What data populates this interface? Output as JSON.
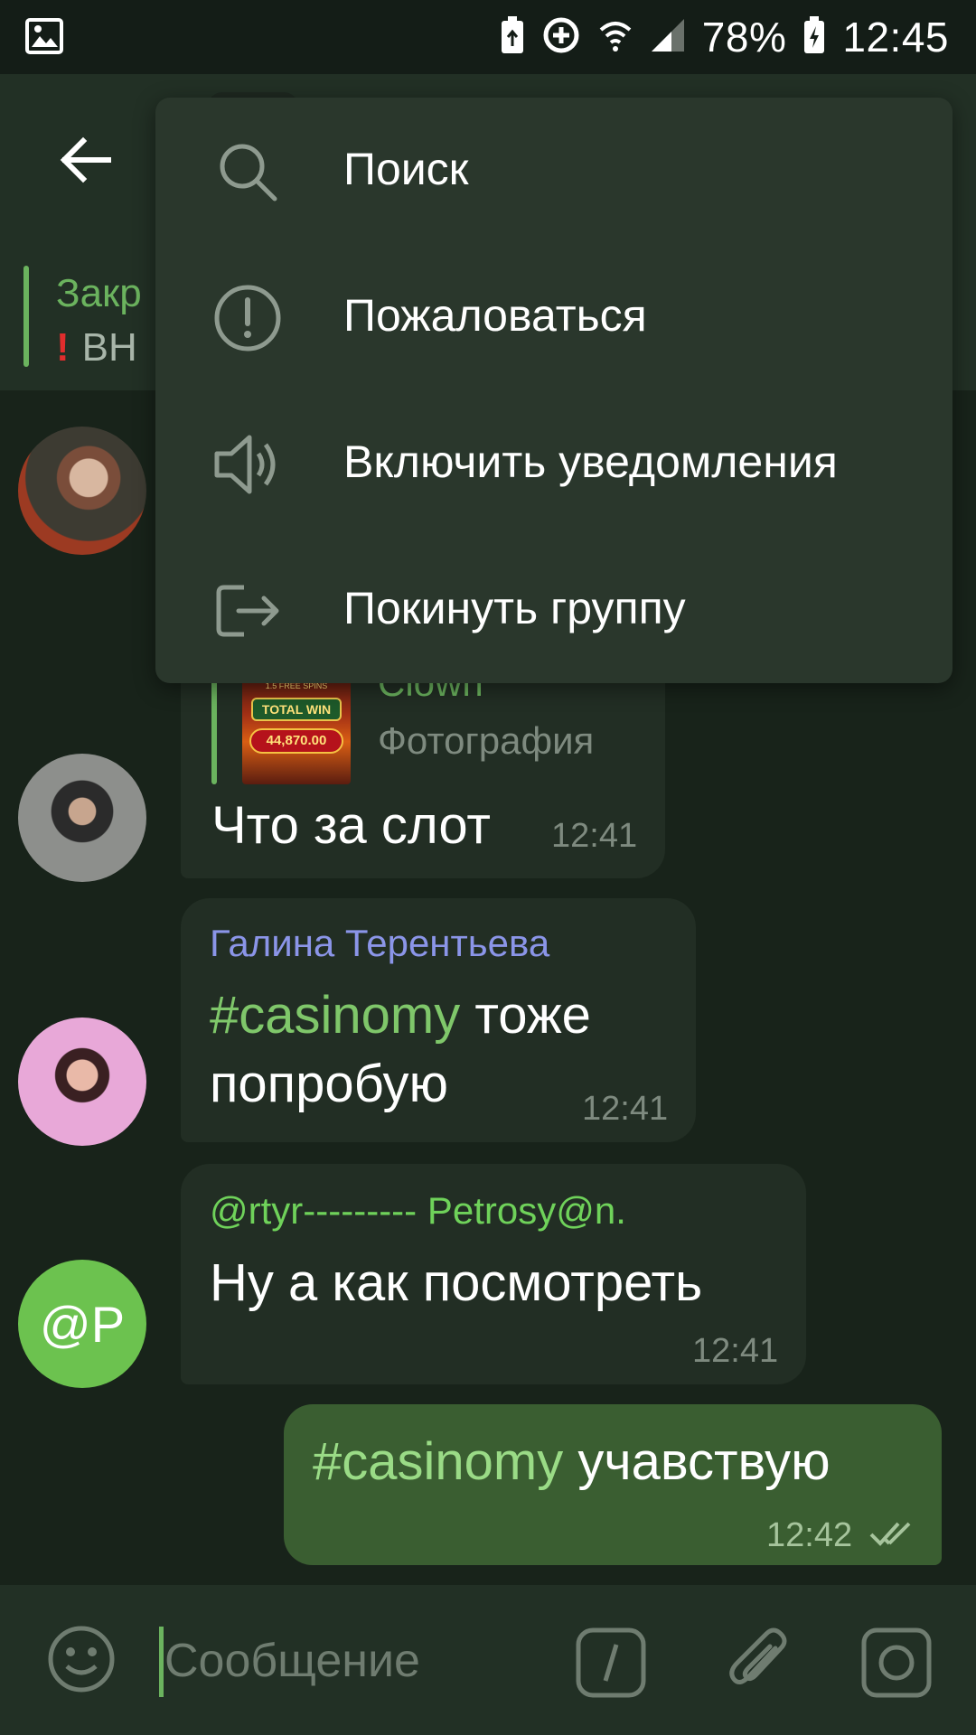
{
  "status_bar": {
    "battery": "78%",
    "time": "12:45"
  },
  "pinned": {
    "title": "Закр",
    "text": "ВН"
  },
  "menu": {
    "items": [
      {
        "label": "Поиск",
        "icon": "search-icon"
      },
      {
        "label": "Пожаловаться",
        "icon": "report-icon"
      },
      {
        "label": "Включить уведомления",
        "icon": "speaker-icon"
      },
      {
        "label": "Покинуть группу",
        "icon": "leave-icon"
      }
    ]
  },
  "messages": [
    {
      "reply_name": "Clown",
      "reply_subtitle": "Фотография",
      "reply_thumb": {
        "spins": "1.5 FREE SPINS",
        "banner": "TOTAL WIN",
        "amount": "44,870.00"
      },
      "text": "Что за слот",
      "time": "12:41"
    },
    {
      "sender": "Галина Терентьева",
      "hashtag": "#casinomy",
      "text": " тоже попробую",
      "time": "12:41"
    },
    {
      "sender": "@rtyr--------- Petrosy@n.",
      "avatar_initials": "@P",
      "text": "Ну а как посмотреть",
      "time": "12:41"
    },
    {
      "hashtag": "#casinomy",
      "text": " учавствую",
      "time": "12:42",
      "outgoing": true
    }
  ],
  "input": {
    "placeholder": "Сообщение"
  },
  "colors": {
    "accent": "#6bb35e",
    "background": "#18231a",
    "header": "#223025",
    "menu": "#2a372c",
    "outgoing_bubble": "#3a5e31",
    "incoming_bubble": "#222e24",
    "name_blue": "#8b95e8",
    "name_green": "#6fd25a"
  }
}
